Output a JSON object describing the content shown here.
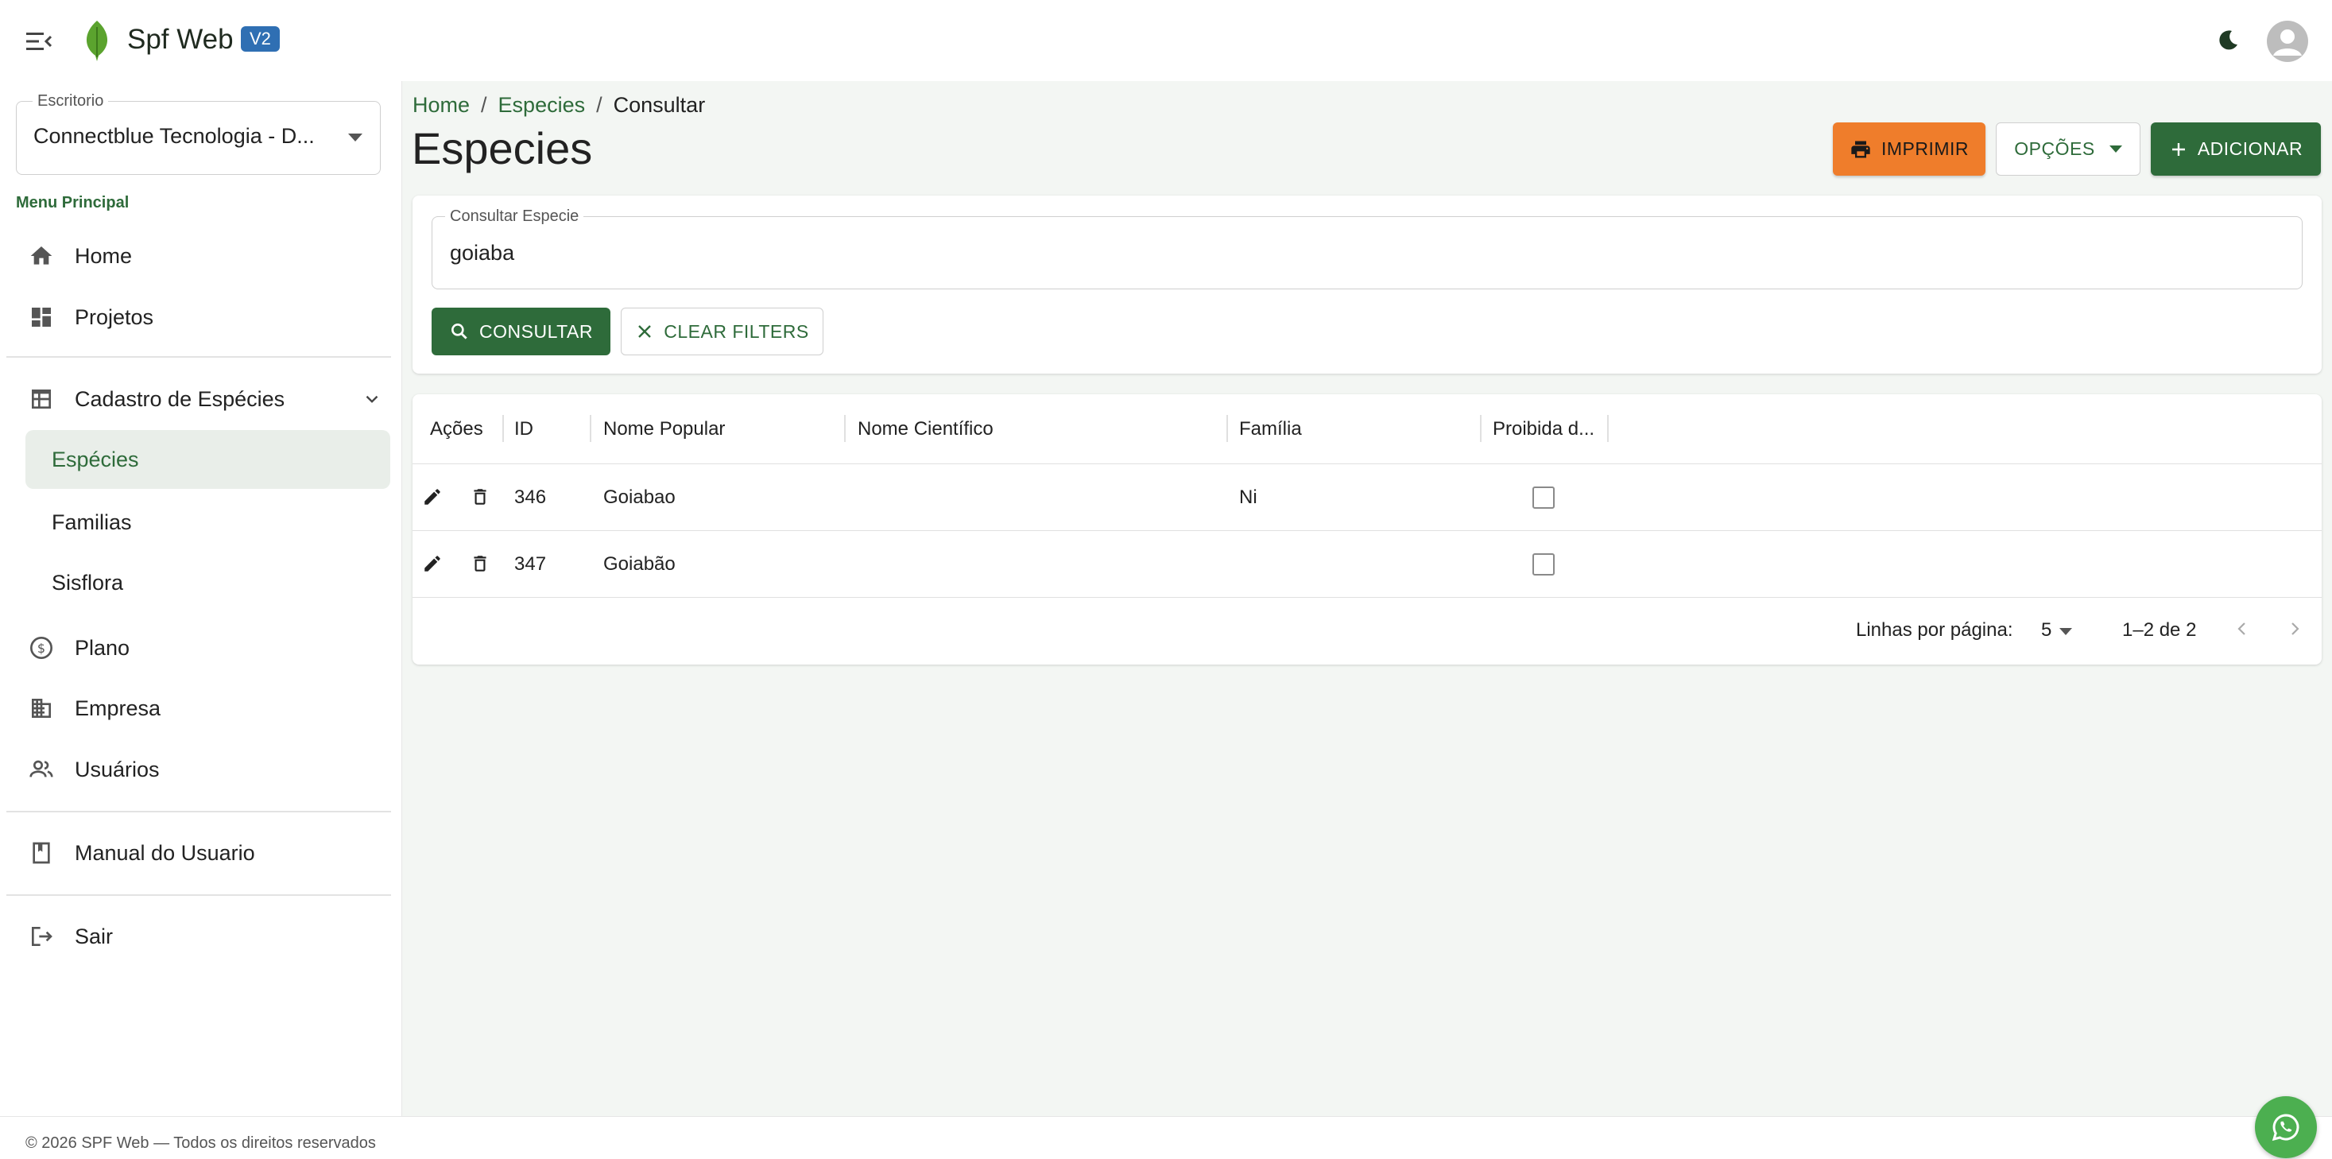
{
  "app": {
    "name": "Spf Web",
    "version": "V2"
  },
  "office": {
    "label": "Escritorio",
    "value": "Connectblue Tecnologia - D..."
  },
  "sidebar": {
    "menu_title": "Menu Principal",
    "items": [
      {
        "label": "Home",
        "icon": "home-icon"
      },
      {
        "label": "Projetos",
        "icon": "dashboard-icon"
      },
      {
        "label": "Cadastro de Espécies",
        "icon": "table-icon"
      },
      {
        "label": "Espécies"
      },
      {
        "label": "Familias"
      },
      {
        "label": "Sisflora"
      },
      {
        "label": "Plano",
        "icon": "dollar-icon"
      },
      {
        "label": "Empresa",
        "icon": "building-icon"
      },
      {
        "label": "Usuários",
        "icon": "users-icon"
      },
      {
        "label": "Manual do Usuario",
        "icon": "book-icon"
      },
      {
        "label": "Sair",
        "icon": "logout-icon"
      }
    ]
  },
  "breadcrumb": {
    "home": "Home",
    "section": "Especies",
    "current": "Consultar",
    "sep": "/"
  },
  "page": {
    "title": "Especies"
  },
  "toolbar": {
    "print_label": "IMPRIMIR",
    "options_label": "OPÇÕES",
    "add_label": "ADICIONAR"
  },
  "filter": {
    "label": "Consultar Especie",
    "value": "goiaba",
    "consult_label": "CONSULTAR",
    "clear_label": "CLEAR FILTERS"
  },
  "table": {
    "columns": [
      "Ações",
      "ID",
      "Nome Popular",
      "Nome Científico",
      "Família",
      "Proibida d..."
    ],
    "rows": [
      {
        "id": "346",
        "nome_popular": "Goiabao",
        "nome_cientifico": "",
        "familia": "Ni",
        "proibida": false
      },
      {
        "id": "347",
        "nome_popular": "Goiabão",
        "nome_cientifico": "",
        "familia": "",
        "proibida": false
      }
    ]
  },
  "pagination": {
    "rows_label": "Linhas por página:",
    "rows_per_page": "5",
    "range": "1–2 de 2"
  },
  "footer": {
    "text": "© 2026 SPF Web — Todos os direitos reservados"
  },
  "colors": {
    "primary": "#2e6b3a",
    "print": "#ef7d2b",
    "version_badge": "#2f6fb3",
    "whatsapp": "#4caf50"
  }
}
